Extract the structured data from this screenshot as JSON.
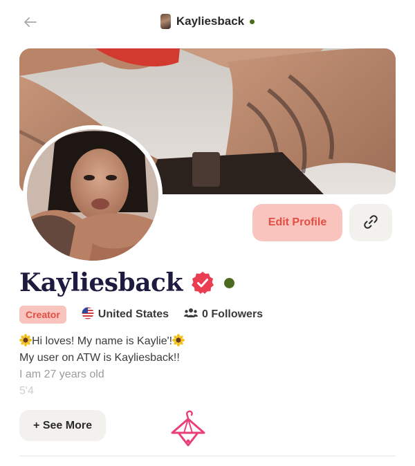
{
  "header": {
    "username": "Kayliesback"
  },
  "profile": {
    "display_name": "Kayliesback",
    "edit_label": "Edit Profile",
    "badge": "Creator",
    "country": "United States",
    "followers": "0 Followers",
    "bio_line_1": "Hi loves! My name is Kaylie'!",
    "bio_line_2": "My user on ATW is Kayliesback!!",
    "bio_line_3": "I am 27 years old",
    "bio_line_4": "5'4",
    "see_more_label": "+ See More"
  },
  "colors": {
    "accent": "#e24e43",
    "accent_soft": "#f8c4bd",
    "online": "#4d6b1f",
    "name": "#1d1b3f",
    "hanger": "#e8407a"
  },
  "icons": [
    "back-arrow-icon",
    "link-icon",
    "verified-badge-icon",
    "us-flag-icon",
    "followers-icon",
    "sunflower-icon",
    "hanger-icon"
  ]
}
